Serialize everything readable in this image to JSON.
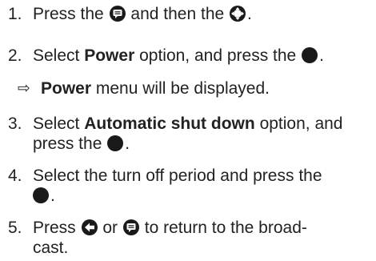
{
  "steps": [
    {
      "number": "1.",
      "line1": {
        "a": "Press the",
        "b": "and then the",
        "c": "."
      }
    },
    {
      "number": "2.",
      "line1": {
        "a": "Select",
        "bold": "Power",
        "b": "option, and press the",
        "c": "."
      }
    },
    {
      "result": {
        "bold": "Power",
        "text": "menu will be displayed."
      }
    },
    {
      "number": "3.",
      "line1": {
        "a": "Select",
        "bold": "Automatic shut down",
        "b": "option, and"
      },
      "line2": {
        "a": "press the",
        "c": "."
      }
    },
    {
      "number": "4.",
      "line1": {
        "a": "Select the turn off period and press the"
      },
      "line2": {
        "c": "."
      }
    },
    {
      "number": "5.",
      "line1": {
        "a": "Press",
        "b": "or",
        "c": "to return to the broad-"
      },
      "line2": {
        "a": "cast."
      }
    }
  ],
  "icons": {
    "menu": "menu-button-icon",
    "navigation": "navigation-pad-icon",
    "ok": "ok-button-icon",
    "back": "back-button-icon"
  },
  "colors": {
    "text": "#222222",
    "icon": "#1a1a1a"
  }
}
